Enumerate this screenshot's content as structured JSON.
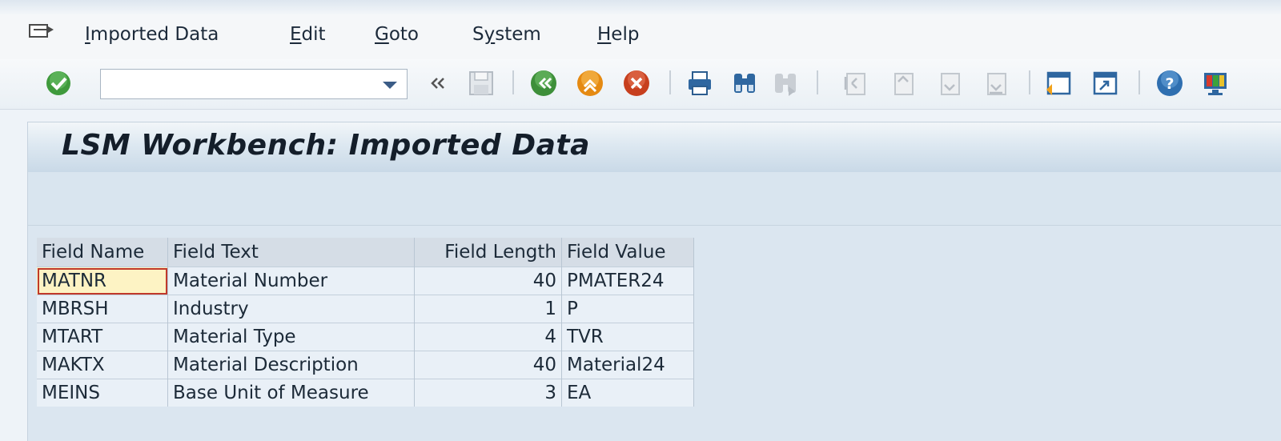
{
  "menubar": {
    "items": [
      {
        "label": "Imported Data",
        "mnemonic": "I"
      },
      {
        "label": "Edit",
        "mnemonic": "E"
      },
      {
        "label": "Goto",
        "mnemonic": "G"
      },
      {
        "label": "System",
        "mnemonic": "y"
      },
      {
        "label": "Help",
        "mnemonic": "H"
      }
    ]
  },
  "toolbar": {
    "command_value": "",
    "icons": [
      "enter-icon",
      "command-field",
      "collapse-icon",
      "save-icon",
      "back-icon",
      "exit-icon",
      "cancel-icon",
      "print-icon",
      "find-icon",
      "find-next-icon",
      "first-page-icon",
      "previous-page-icon",
      "next-page-icon",
      "last-page-icon",
      "create-session-icon",
      "shortcut-icon",
      "help-icon",
      "layout-menu-icon"
    ]
  },
  "page": {
    "title": "LSM Workbench: Imported Data"
  },
  "table": {
    "columns": [
      "Field Name",
      "Field Text",
      "Field Length",
      "Field Value"
    ],
    "rows": [
      [
        "MATNR",
        "Material Number",
        "40",
        "PMATER24"
      ],
      [
        "MBRSH",
        "Industry",
        "1",
        "P"
      ],
      [
        "MTART",
        "Material Type",
        "4",
        "TVR"
      ],
      [
        "MAKTX",
        "Material Description",
        "40",
        "Material24"
      ],
      [
        "MEINS",
        "Base Unit of Measure",
        "3",
        "EA"
      ]
    ]
  },
  "colors": {
    "active_cell_bg": "#fdf3c4",
    "active_cell_border": "#c0392b",
    "accent": "#3b5c86"
  }
}
